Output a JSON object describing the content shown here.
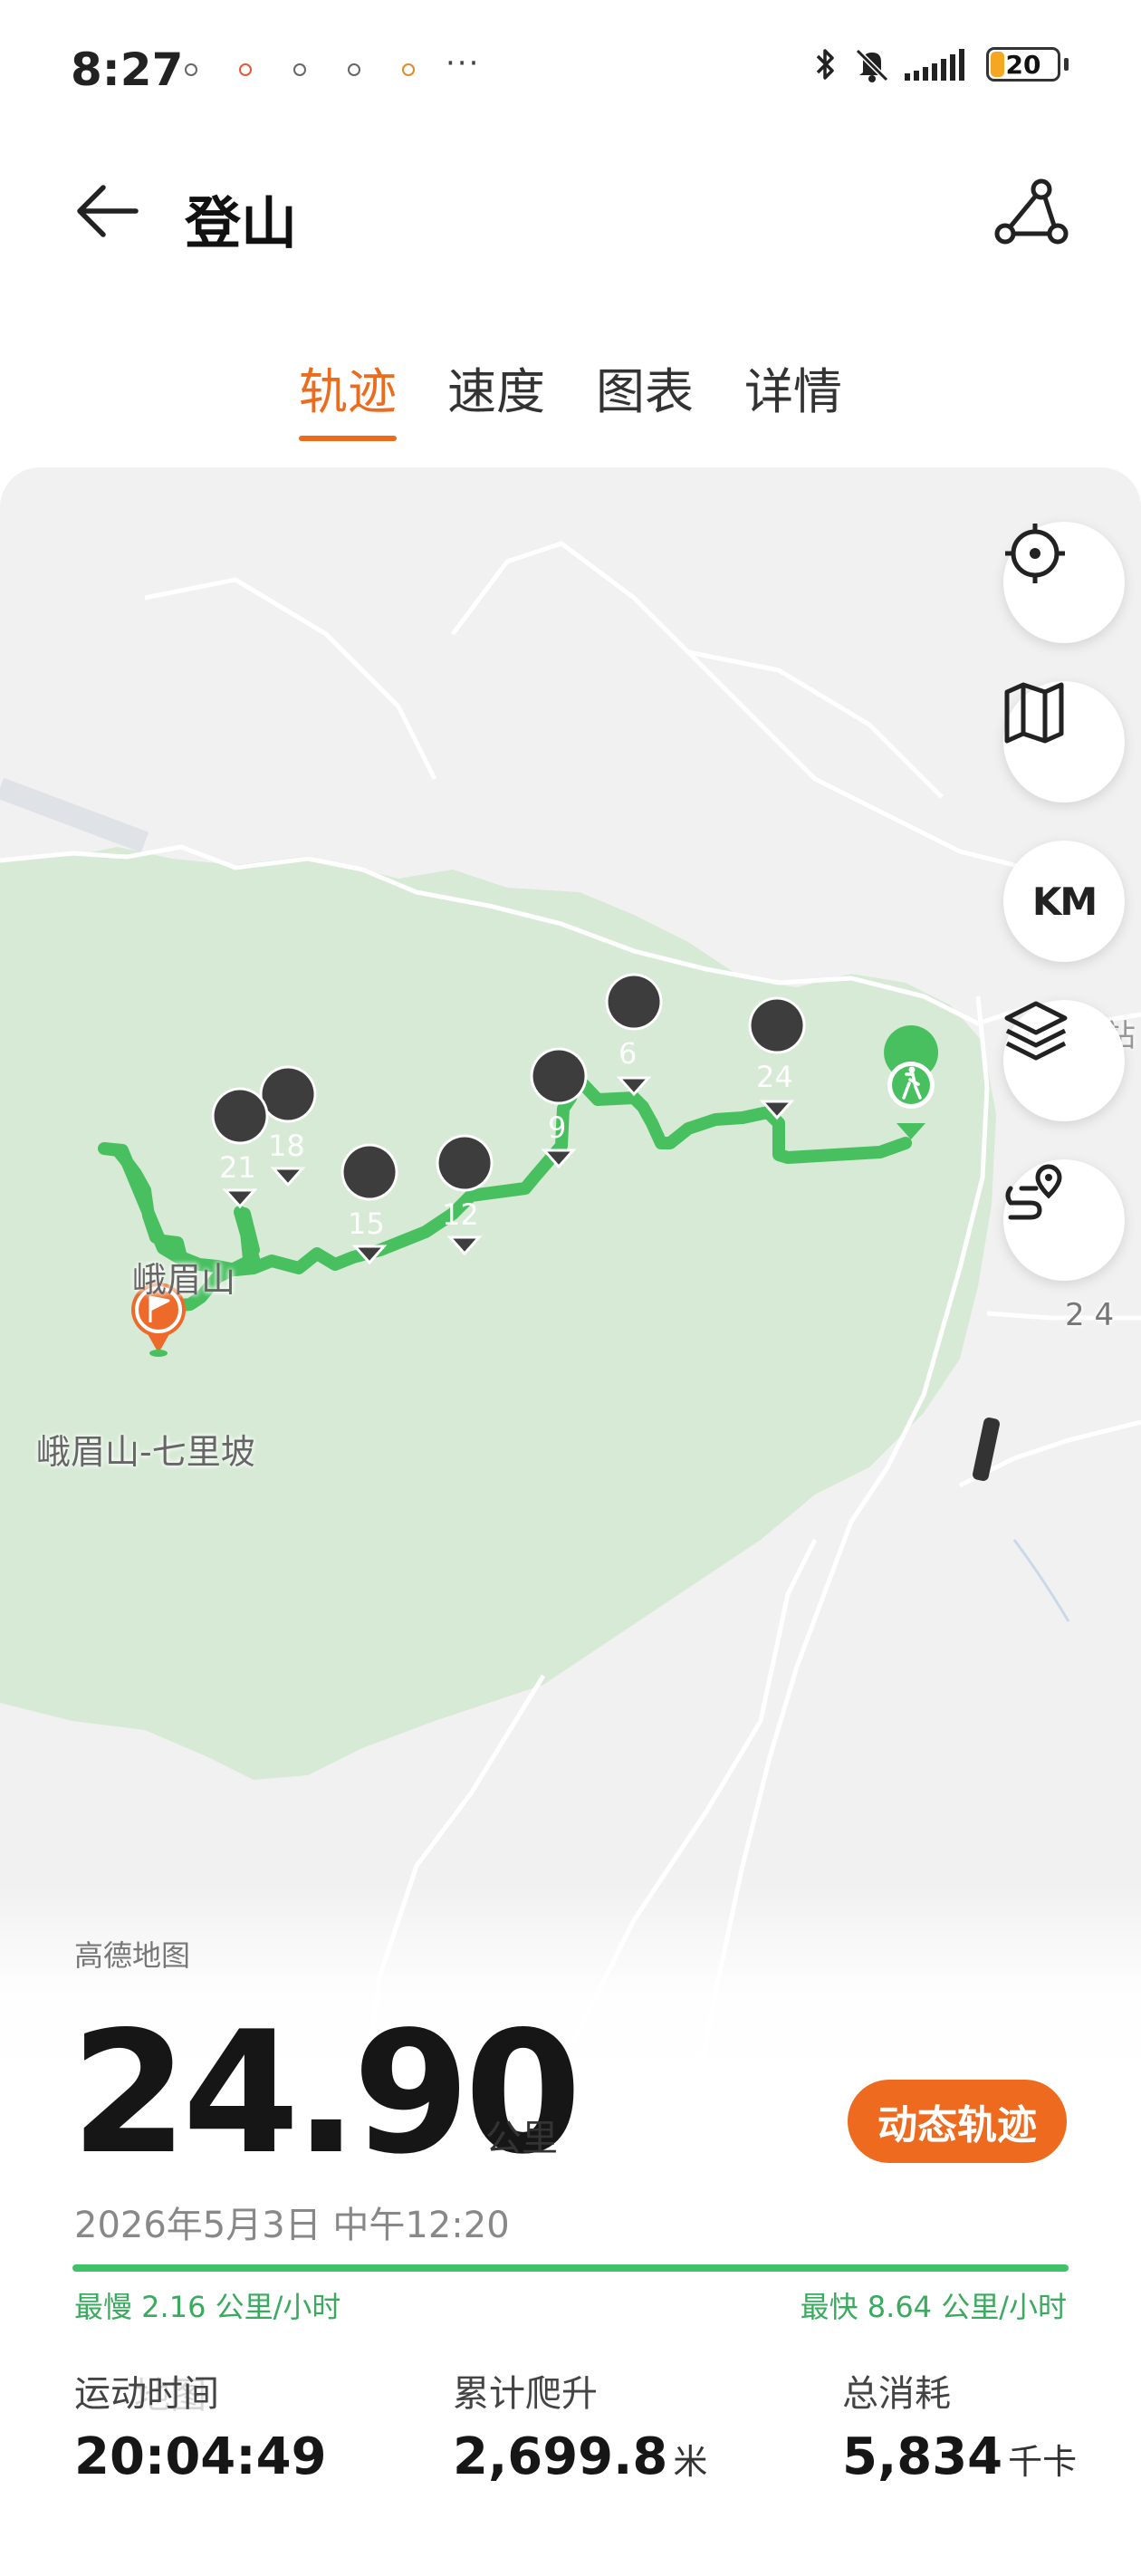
{
  "status_bar": {
    "time": "8:27",
    "more": "···",
    "battery": "20",
    "icons": [
      "bluetooth-icon",
      "mute-icon",
      "signal-icon",
      "battery-icon"
    ]
  },
  "header": {
    "title": "登山",
    "back_icon": "arrow-left-icon",
    "share_icon": "route-share-icon"
  },
  "tabs": [
    {
      "label": "轨迹",
      "active": true
    },
    {
      "label": "速度",
      "active": false
    },
    {
      "label": "图表",
      "active": false
    },
    {
      "label": "详情",
      "active": false
    }
  ],
  "map": {
    "labels": {
      "mountain": "峨眉山",
      "place": "峨眉山-七里坡",
      "edge_digits": "2 4",
      "edge_char": "站"
    },
    "km_markers": [
      "6",
      "9",
      "12",
      "15",
      "18",
      "21",
      "24"
    ],
    "controls": {
      "locate": "target-icon",
      "map_type": "map-icon",
      "km_toggle": "KM",
      "layers": "layers-icon",
      "route": "route-pin-icon"
    },
    "colors": {
      "track": "#49c060",
      "forest": "#d6ead5",
      "finish": "#ee6a2a"
    }
  },
  "summary": {
    "provider": "高德地图",
    "distance": "24.90",
    "distance_unit": "公里",
    "animate_label": "动态轨迹",
    "datetime": "2026年5月3日 中午12:20",
    "speed_min_label": "最慢 2.16 公里/小时",
    "speed_max_label": "最快 8.64 公里/小时",
    "watermark": "地图",
    "stats": [
      {
        "label": "运动时间",
        "value": "20:04:49",
        "unit": ""
      },
      {
        "label": "累计爬升",
        "value": "2,699.8",
        "unit": "米"
      },
      {
        "label": "总消耗",
        "value": "5,834",
        "unit": "千卡"
      }
    ]
  },
  "accent_color": "#ec6b1c"
}
